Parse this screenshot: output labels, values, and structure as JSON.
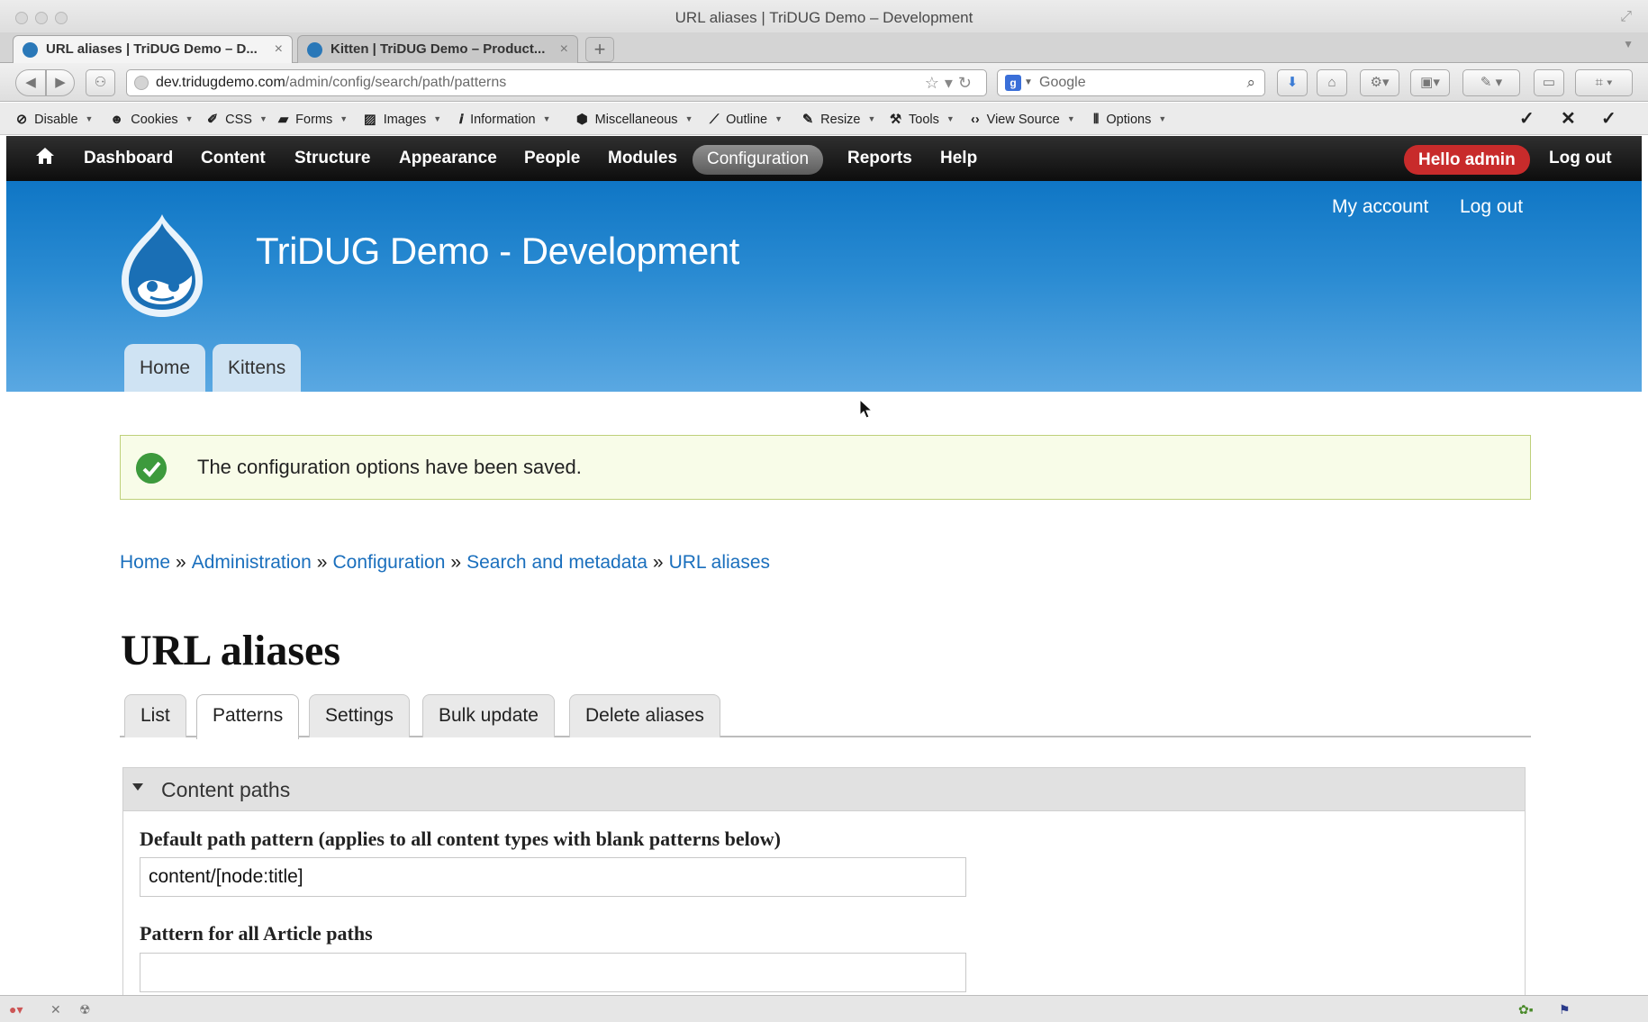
{
  "window": {
    "title": "URL aliases | TriDUG Demo – Development"
  },
  "tabs": [
    {
      "label": "URL aliases | TriDUG Demo – D...",
      "active": true
    },
    {
      "label": "Kitten | TriDUG Demo – Product...",
      "active": false
    }
  ],
  "urlbar": {
    "host": "dev.tridugdemo.com",
    "path": "/admin/config/search/path/patterns"
  },
  "searchbar": {
    "engine": "g",
    "placeholder": "Google"
  },
  "devbar": {
    "items": [
      "Disable",
      "Cookies",
      "CSS",
      "Forms",
      "Images",
      "Information",
      "Miscellaneous",
      "Outline",
      "Resize",
      "Tools",
      "View Source",
      "Options"
    ]
  },
  "admin_menu": {
    "items": [
      "Dashboard",
      "Content",
      "Structure",
      "Appearance",
      "People",
      "Modules",
      "Configuration",
      "Reports",
      "Help"
    ],
    "active": "Configuration",
    "hello": "Hello admin",
    "logout": "Log out"
  },
  "site": {
    "name": "TriDUG Demo - Development",
    "secondary_links": [
      "My account",
      "Log out"
    ],
    "main_tabs": [
      "Home",
      "Kittens"
    ],
    "header_color": "#1a7dc9"
  },
  "status_message": {
    "text": "The configuration options have been saved.",
    "color": "#3d9a3d"
  },
  "breadcrumb": [
    "Home",
    "Administration",
    "Configuration",
    "Search and metadata",
    "URL aliases"
  ],
  "breadcrumb_separator": "»",
  "page_title": "URL aliases",
  "local_tabs": {
    "items": [
      "List",
      "Patterns",
      "Settings",
      "Bulk update",
      "Delete aliases"
    ],
    "active": "Patterns"
  },
  "fieldset": {
    "legend": "Content paths",
    "fields": [
      {
        "label": "Default path pattern (applies to all content types with blank patterns below)",
        "value": "content/[node:title]"
      },
      {
        "label": "Pattern for all Article paths",
        "value": ""
      }
    ]
  }
}
